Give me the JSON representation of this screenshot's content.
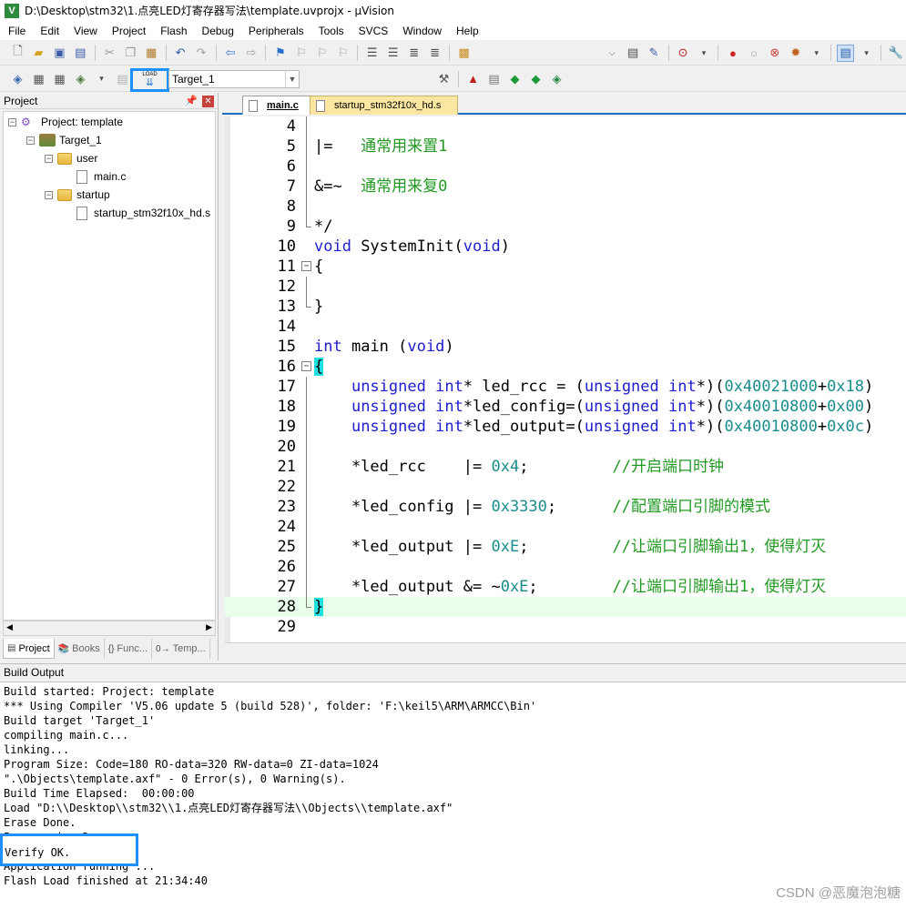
{
  "window": {
    "title": "D:\\Desktop\\stm32\\1.点亮LED灯寄存器写法\\template.uvprojx - µVision",
    "icon": "V"
  },
  "menu": [
    "File",
    "Edit",
    "View",
    "Project",
    "Flash",
    "Debug",
    "Peripherals",
    "Tools",
    "SVCS",
    "Window",
    "Help"
  ],
  "toolbar2": {
    "target": "Target_1",
    "load_label": "LOAD"
  },
  "project_panel": {
    "title": "Project",
    "root": "Project: template",
    "target": "Target_1",
    "groups": [
      {
        "name": "user",
        "files": [
          "main.c"
        ]
      },
      {
        "name": "startup",
        "files": [
          "startup_stm32f10x_hd.s"
        ]
      }
    ],
    "tabs": [
      "Project",
      "Books",
      "Func...",
      "Temp..."
    ]
  },
  "editor": {
    "tabs": [
      "main.c",
      "startup_stm32f10x_hd.s"
    ],
    "lines": [
      {
        "n": "4",
        "text": ""
      },
      {
        "n": "5",
        "text": "|=   通常用来置1"
      },
      {
        "n": "6",
        "text": ""
      },
      {
        "n": "7",
        "text": "&=~  通常用来复0"
      },
      {
        "n": "8",
        "text": ""
      },
      {
        "n": "9",
        "text": "*/"
      },
      {
        "n": "10",
        "text": "void SystemInit(void)"
      },
      {
        "n": "11",
        "text": "{"
      },
      {
        "n": "12",
        "text": ""
      },
      {
        "n": "13",
        "text": "}"
      },
      {
        "n": "14",
        "text": ""
      },
      {
        "n": "15",
        "text": "int main (void)"
      },
      {
        "n": "16",
        "text": "{"
      },
      {
        "n": "17",
        "text": "    unsigned int* led_rcc = (unsigned int*)(0x40021000+0x18)"
      },
      {
        "n": "18",
        "text": "    unsigned int*led_config=(unsigned int*)(0x40010800+0x00)"
      },
      {
        "n": "19",
        "text": "    unsigned int*led_output=(unsigned int*)(0x40010800+0x0c)"
      },
      {
        "n": "20",
        "text": ""
      },
      {
        "n": "21",
        "text": "    *led_rcc    |= 0x4;         //开启端口时钟"
      },
      {
        "n": "22",
        "text": ""
      },
      {
        "n": "23",
        "text": "    *led_config |= 0x3330;      //配置端口引脚的模式"
      },
      {
        "n": "24",
        "text": ""
      },
      {
        "n": "25",
        "text": "    *led_output |= 0xE;         //让端口引脚输出1，使得灯灭"
      },
      {
        "n": "26",
        "text": ""
      },
      {
        "n": "27",
        "text": "    *led_output &= ~0xE;        //让端口引脚输出1，使得灯灭"
      },
      {
        "n": "28",
        "text": "}"
      },
      {
        "n": "29",
        "text": ""
      }
    ]
  },
  "build_output": {
    "title": "Build Output",
    "lines": [
      "Build started: Project: template",
      "*** Using Compiler 'V5.06 update 5 (build 528)', folder: 'F:\\keil5\\ARM\\ARMCC\\Bin'",
      "Build target 'Target_1'",
      "compiling main.c...",
      "linking...",
      "Program Size: Code=180 RO-data=320 RW-data=0 ZI-data=1024",
      "\".\\Objects\\template.axf\" - 0 Error(s), 0 Warning(s).",
      "Build Time Elapsed:  00:00:00",
      "Load \"D:\\\\Desktop\\\\stm32\\\\1.点亮LED灯寄存器写法\\\\Objects\\\\template.axf\"",
      "Erase Done.",
      "Programming Done.",
      "Verify OK.",
      "Application running ...",
      "Flash Load finished at 21:34:40"
    ]
  },
  "watermark": "CSDN @恶魔泡泡糖",
  "colors": {
    "keyword": "#1d1dcd",
    "number": "#1a8c8c",
    "comment": "#229922",
    "highlight": "#1e90ff"
  }
}
